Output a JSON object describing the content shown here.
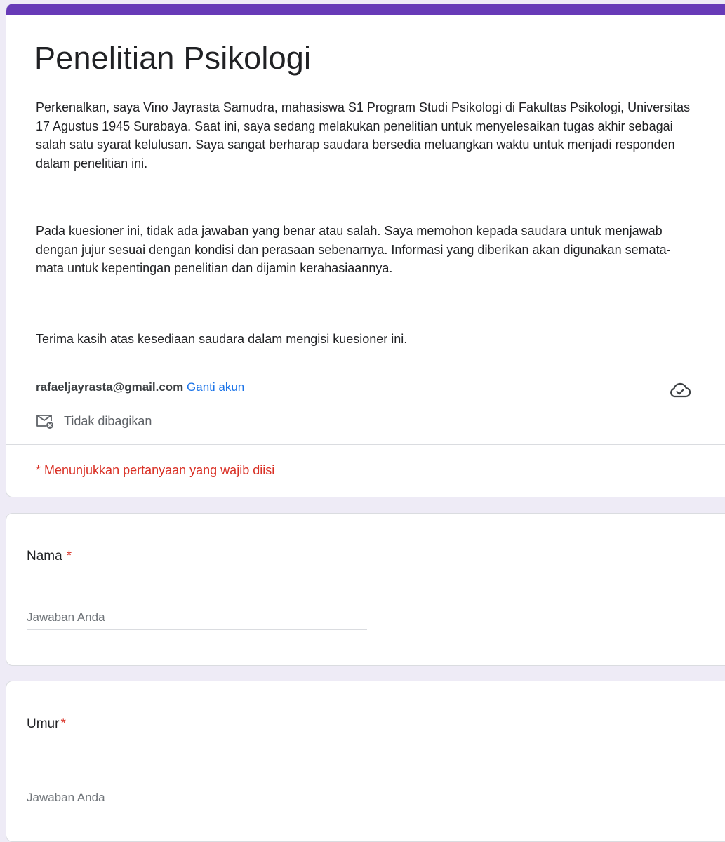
{
  "form": {
    "title": "Penelitian Psikologi",
    "accent_color": "#673ab7",
    "description": [
      "Perkenalkan, saya Vino Jayrasta Samudra, mahasiswa S1 Program Studi Psikologi di Fakultas Psikologi, Universitas 17 Agustus 1945 Surabaya. Saat ini, saya sedang melakukan penelitian untuk menyelesaikan tugas akhir sebagai salah satu syarat kelulusan. Saya sangat berharap saudara bersedia meluangkan waktu untuk menjadi responden dalam penelitian ini.",
      "Pada kuesioner ini, tidak ada jawaban yang benar atau salah. Saya memohon kepada saudara untuk menjawab dengan jujur sesuai dengan kondisi dan perasaan sebenarnya. Informasi yang diberikan akan digunakan semata-mata untuk kepentingan penelitian dan dijamin kerahasiaannya.",
      "Terima kasih atas kesediaan saudara dalam mengisi kuesioner ini."
    ]
  },
  "account": {
    "email": "rafaeljayrasta@gmail.com",
    "switch_label": "Ganti akun",
    "share_status": "Tidak dibagikan",
    "share_icon": "mail-not-shared-icon",
    "save_status_icon": "cloud-saved-icon"
  },
  "required_note": "* Menunjukkan pertanyaan yang wajib diisi",
  "required_color": "#d93025",
  "questions": [
    {
      "label": "Nama",
      "required_mark": "*",
      "placeholder": "Jawaban Anda",
      "value": ""
    },
    {
      "label": "Umur",
      "required_mark": "*",
      "placeholder": "Jawaban Anda",
      "value": ""
    }
  ]
}
